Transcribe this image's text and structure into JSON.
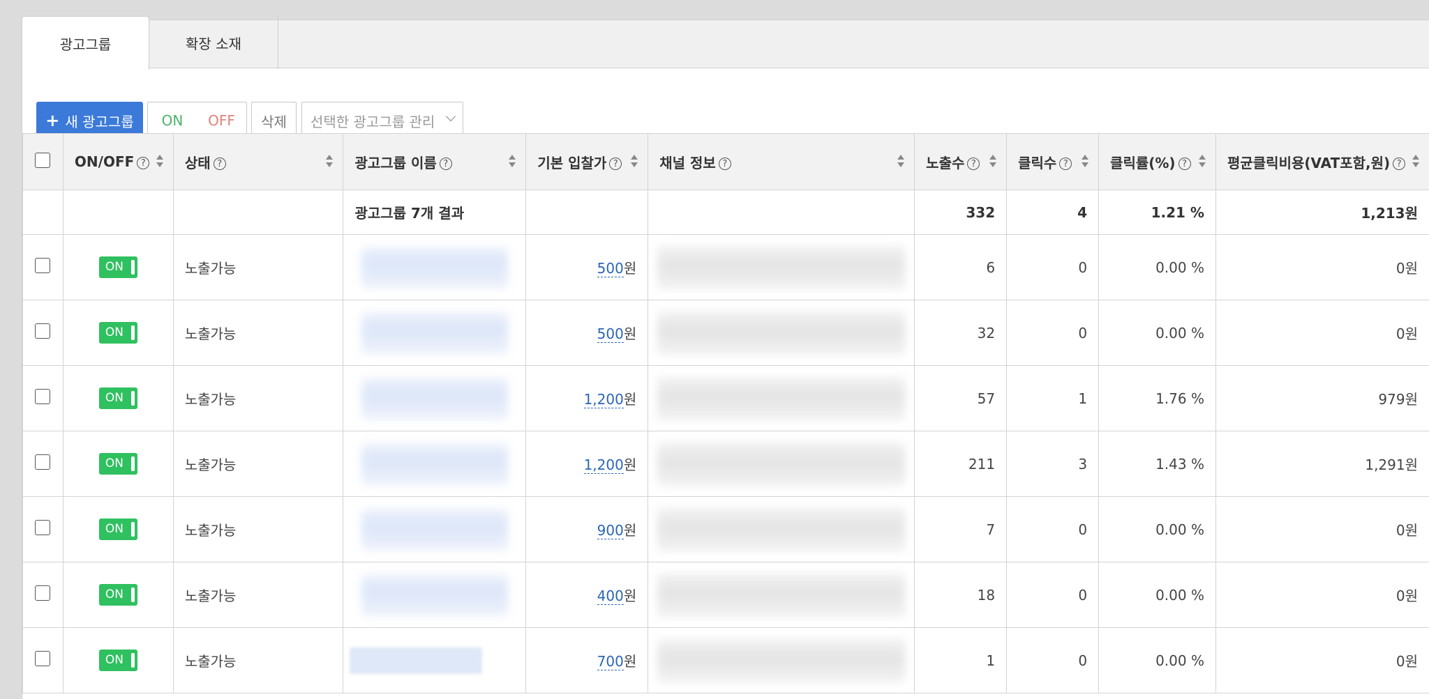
{
  "tabs": [
    {
      "label": "광고그룹",
      "active": true
    },
    {
      "label": "확장 소재",
      "active": false
    }
  ],
  "toolbar": {
    "new_group_label": "새 광고그룹",
    "on_label": "ON",
    "off_label": "OFF",
    "delete_label": "삭제",
    "manage_placeholder": "선택한 광고그룹 관리"
  },
  "columns": {
    "onoff": "ON/OFF",
    "status": "상태",
    "name": "광고그룹 이름",
    "bid": "기본 입찰가",
    "channel": "채널 정보",
    "impressions": "노출수",
    "clicks": "클릭수",
    "ctr": "클릭률(%)",
    "cpc": "평균클릭비용(VAT포함,원)"
  },
  "help_glyph": "?",
  "summary": {
    "label": "광고그룹 7개 결과",
    "impressions": "332",
    "clicks": "4",
    "ctr": "1.21 %",
    "cpc": "1,213원"
  },
  "rows": [
    {
      "toggle": "ON",
      "status": "노출가능",
      "bid": "500",
      "bid_unit": "원",
      "impressions": "6",
      "clicks": "0",
      "ctr": "0.00 %",
      "cpc": "0원"
    },
    {
      "toggle": "ON",
      "status": "노출가능",
      "bid": "500",
      "bid_unit": "원",
      "impressions": "32",
      "clicks": "0",
      "ctr": "0.00 %",
      "cpc": "0원"
    },
    {
      "toggle": "ON",
      "status": "노출가능",
      "bid": "1,200",
      "bid_unit": "원",
      "impressions": "57",
      "clicks": "1",
      "ctr": "1.76 %",
      "cpc": "979원"
    },
    {
      "toggle": "ON",
      "status": "노출가능",
      "bid": "1,200",
      "bid_unit": "원",
      "impressions": "211",
      "clicks": "3",
      "ctr": "1.43 %",
      "cpc": "1,291원"
    },
    {
      "toggle": "ON",
      "status": "노출가능",
      "bid": "900",
      "bid_unit": "원",
      "impressions": "7",
      "clicks": "0",
      "ctr": "0.00 %",
      "cpc": "0원"
    },
    {
      "toggle": "ON",
      "status": "노출가능",
      "bid": "400",
      "bid_unit": "원",
      "impressions": "18",
      "clicks": "0",
      "ctr": "0.00 %",
      "cpc": "0원"
    },
    {
      "toggle": "ON",
      "status": "노출가능",
      "bid": "700",
      "bid_unit": "원",
      "impressions": "1",
      "clicks": "0",
      "ctr": "0.00 %",
      "cpc": "0원"
    }
  ],
  "colors": {
    "primary": "#3b7ad9",
    "toggle_on": "#2fc05f",
    "on_text": "#4cb36a",
    "off_text": "#e0827a",
    "link": "#2a66b8"
  }
}
